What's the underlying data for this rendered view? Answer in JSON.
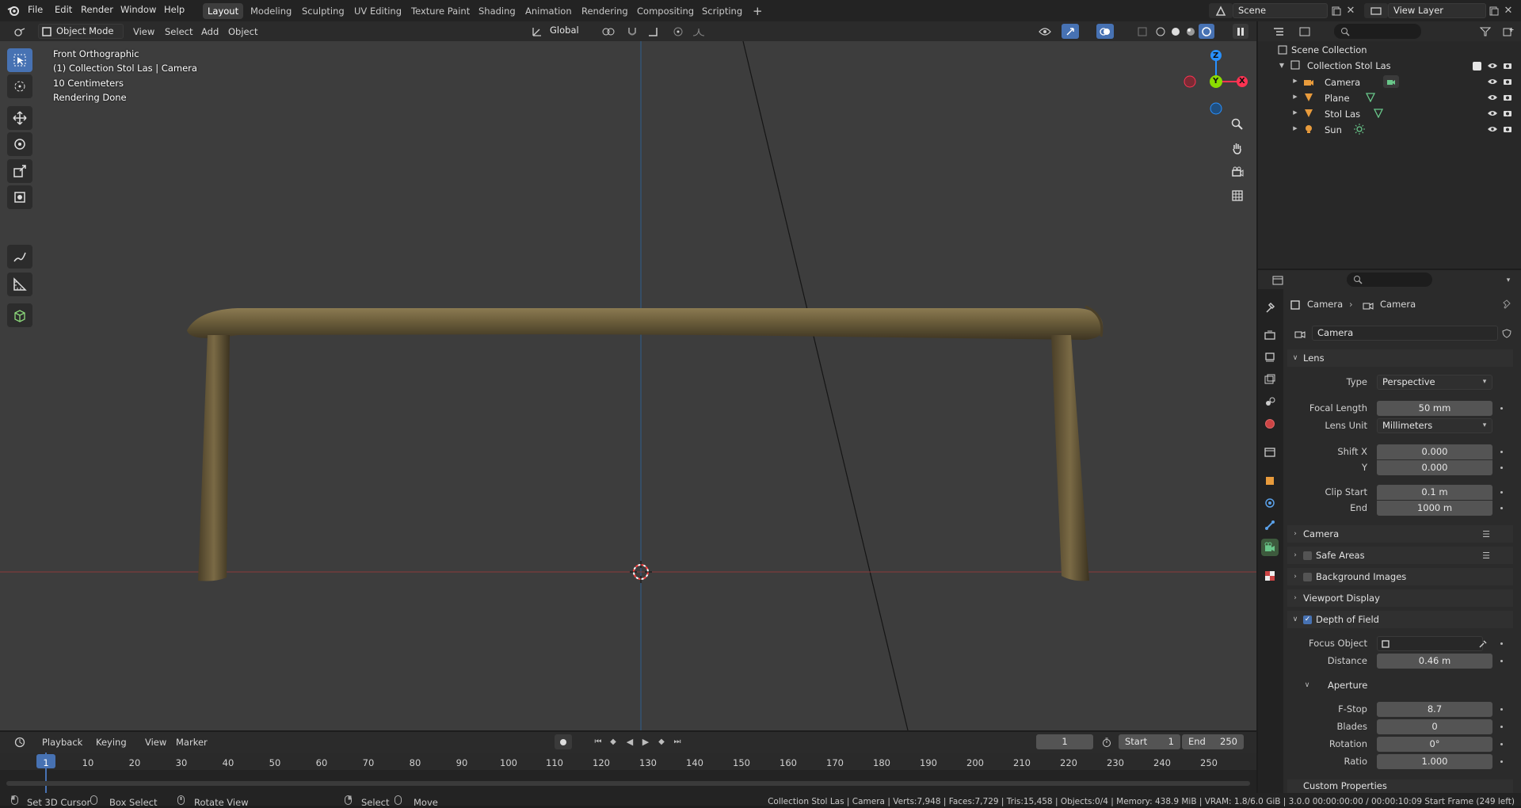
{
  "topbar": {
    "menus": [
      "File",
      "Edit",
      "Render",
      "Window",
      "Help"
    ],
    "workspaces": [
      "Layout",
      "Modeling",
      "Sculpting",
      "UV Editing",
      "Texture Paint",
      "Shading",
      "Animation",
      "Rendering",
      "Compositing",
      "Scripting"
    ],
    "active_workspace": "Layout",
    "add_tab": "+",
    "scene": "Scene",
    "view_layer": "View Layer"
  },
  "viewport_header": {
    "mode": "Object Mode",
    "menus": [
      "View",
      "Select",
      "Add",
      "Object"
    ],
    "orientation": "Global"
  },
  "viewport_overlay": {
    "view_name": "Front Orthographic",
    "collection": "(1) Collection Stol Las | Camera",
    "scale": "10 Centimeters",
    "status": "Rendering Done"
  },
  "gizmo": {
    "x": "X",
    "y": "Y",
    "z": "Z"
  },
  "outliner": {
    "root": "Scene Collection",
    "collection": "Collection Stol Las",
    "objects": [
      "Camera",
      "Plane",
      "Stol Las",
      "Sun"
    ]
  },
  "properties": {
    "breadcrumb": [
      "Camera",
      "Camera"
    ],
    "datablock": "Camera",
    "lens": {
      "title": "Lens",
      "type_label": "Type",
      "type": "Perspective",
      "focal_label": "Focal Length",
      "focal": "50 mm",
      "unit_label": "Lens Unit",
      "unit": "Millimeters",
      "shiftx_label": "Shift X",
      "shiftx": "0.000",
      "shifty_label": "Y",
      "shifty": "0.000",
      "clipstart_label": "Clip Start",
      "clipstart": "0.1 m",
      "clipend_label": "End",
      "clipend": "1000 m"
    },
    "panels": [
      "Camera",
      "Safe Areas",
      "Background Images",
      "Viewport Display",
      "Depth of Field"
    ],
    "dof": {
      "focus_label": "Focus Object",
      "distance_label": "Distance",
      "distance": "0.46 m",
      "aperture": "Aperture",
      "fstop_label": "F-Stop",
      "fstop": "8.7",
      "blades_label": "Blades",
      "blades": "0",
      "rotation_label": "Rotation",
      "rotation": "0°",
      "ratio_label": "Ratio",
      "ratio": "1.000"
    },
    "custom": "Custom Properties"
  },
  "timeline": {
    "menus": [
      "Playback",
      "Keying",
      "View",
      "Marker"
    ],
    "current_frame": "1",
    "start_label": "Start",
    "start": "1",
    "end_label": "End",
    "end": "250",
    "ruler": [
      "1",
      "10",
      "20",
      "30",
      "40",
      "50",
      "60",
      "70",
      "80",
      "90",
      "100",
      "110",
      "120",
      "130",
      "140",
      "150",
      "160",
      "170",
      "180",
      "190",
      "200",
      "210",
      "220",
      "230",
      "240",
      "250"
    ]
  },
  "statusbar": {
    "hints": [
      "Set 3D Cursor",
      "Box Select",
      "Rotate View",
      "Select",
      "Move"
    ],
    "info": "Collection Stol Las | Camera | Verts:7,948 | Faces:7,729 | Tris:15,458 | Objects:0/4 | Memory: 438.9 MiB | VRAM: 1.8/6.0 GiB | 3.0.0  00:00:00:00 / 00:00:10:09  Start Frame (249 left)"
  },
  "colors": {
    "accent": "#4772b3",
    "x_axis": "#ff3352",
    "y_axis": "#8bdc00",
    "z_axis": "#2890ff",
    "viewport_bg": "#3d3d3d"
  }
}
